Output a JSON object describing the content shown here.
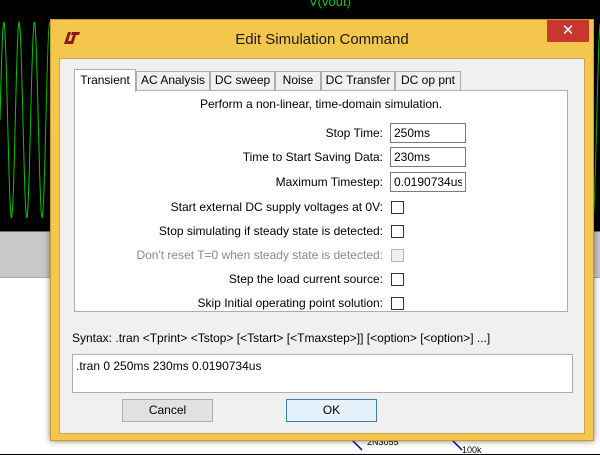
{
  "background": {
    "trace_label": "V(vout)",
    "schematic_labels": [
      "2N3055",
      "100k"
    ]
  },
  "dialog": {
    "title": "Edit Simulation Command",
    "close_glyph": "✕",
    "app_icon": "ltspice-logo-icon",
    "tabs": [
      {
        "label": "Transient",
        "active": true
      },
      {
        "label": "AC Analysis",
        "active": false
      },
      {
        "label": "DC sweep",
        "active": false
      },
      {
        "label": "Noise",
        "active": false
      },
      {
        "label": "DC Transfer",
        "active": false
      },
      {
        "label": "DC op pnt",
        "active": false
      }
    ],
    "panel": {
      "description": "Perform a non-linear, time-domain simulation.",
      "fields": [
        {
          "label": "Stop Time:",
          "value": "250ms"
        },
        {
          "label": "Time to Start Saving Data:",
          "value": "230ms"
        },
        {
          "label": "Maximum Timestep:",
          "value": "0.0190734us"
        }
      ],
      "checkboxes": [
        {
          "label": "Start external DC supply voltages at 0V:",
          "checked": false,
          "enabled": true
        },
        {
          "label": "Stop simulating if steady state is detected:",
          "checked": false,
          "enabled": true
        },
        {
          "label": "Don't reset T=0 when steady state is detected:",
          "checked": false,
          "enabled": false
        },
        {
          "label": "Step the load current source:",
          "checked": false,
          "enabled": true
        },
        {
          "label": "Skip Initial operating point solution:",
          "checked": false,
          "enabled": true
        }
      ]
    },
    "syntax": "Syntax:  .tran <Tprint> <Tstop> [<Tstart> [<Tmaxstep>]] [<option> [<option>] ...]",
    "command": ".tran 0 250ms 230ms 0.0190734us",
    "buttons": {
      "cancel": "Cancel",
      "ok": "OK"
    }
  },
  "colors": {
    "dialog_frame": "#f5c64c",
    "close_button": "#c7372f",
    "trace": "#00c800"
  }
}
